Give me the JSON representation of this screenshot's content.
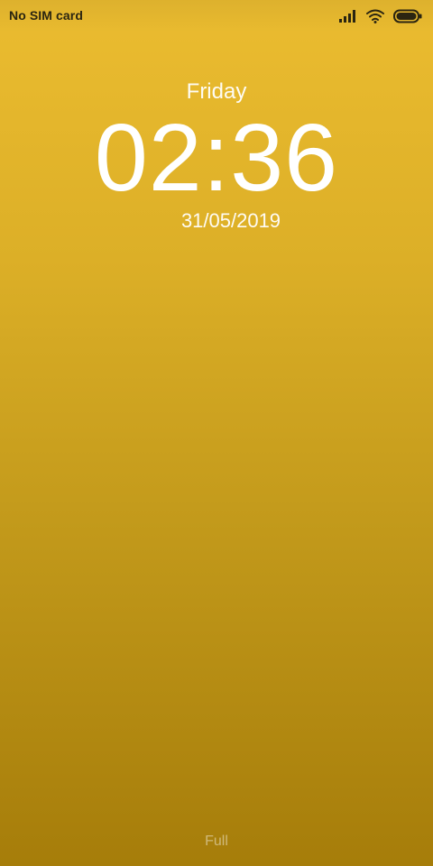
{
  "status_bar": {
    "carrier": "No SIM card",
    "icons": [
      "signal-icon",
      "wifi-icon",
      "battery-icon"
    ],
    "text_color": "#2b2511"
  },
  "lock_screen": {
    "day": "Friday",
    "time": "02:36",
    "date": "31/05/2019",
    "text_color": "#ffffff"
  },
  "bottom": {
    "label": "Full"
  },
  "background": {
    "top_color": "#ebbc30",
    "bottom_color": "#a67d0a"
  }
}
